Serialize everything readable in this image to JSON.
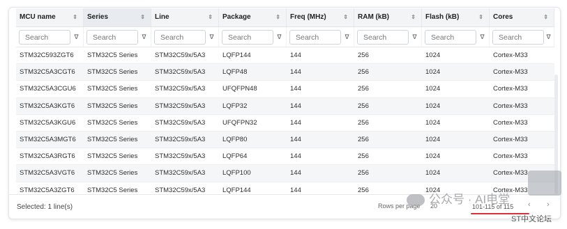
{
  "columns": [
    {
      "label": "MCU name",
      "width": 97
    },
    {
      "label": "Series",
      "width": 97,
      "active": true
    },
    {
      "label": "Line",
      "width": 97
    },
    {
      "label": "Package",
      "width": 97
    },
    {
      "label": "Freq (MHz)",
      "width": 97
    },
    {
      "label": "RAM (kB)",
      "width": 97
    },
    {
      "label": "Flash (kB)",
      "width": 97
    },
    {
      "label": "Cores",
      "width": 93
    }
  ],
  "filter_placeholder": "Search",
  "rows": [
    [
      "STM32C593ZGT6",
      "STM32C5 Series",
      "STM32C59x/5A3",
      "LQFP144",
      "144",
      "256",
      "1024",
      "Cortex-M33"
    ],
    [
      "STM32C5A3CGT6",
      "STM32C5 Series",
      "STM32C59x/5A3",
      "LQFP48",
      "144",
      "256",
      "1024",
      "Cortex-M33"
    ],
    [
      "STM32C5A3CGU6",
      "STM32C5 Series",
      "STM32C59x/5A3",
      "UFQFPN48",
      "144",
      "256",
      "1024",
      "Cortex-M33"
    ],
    [
      "STM32C5A3KGT6",
      "STM32C5 Series",
      "STM32C59x/5A3",
      "LQFP32",
      "144",
      "256",
      "1024",
      "Cortex-M33"
    ],
    [
      "STM32C5A3KGU6",
      "STM32C5 Series",
      "STM32C59x/5A3",
      "UFQFPN32",
      "144",
      "256",
      "1024",
      "Cortex-M33"
    ],
    [
      "STM32C5A3MGT6",
      "STM32C5 Series",
      "STM32C59x/5A3",
      "LQFP80",
      "144",
      "256",
      "1024",
      "Cortex-M33"
    ],
    [
      "STM32C5A3RGT6",
      "STM32C5 Series",
      "STM32C59x/5A3",
      "LQFP64",
      "144",
      "256",
      "1024",
      "Cortex-M33"
    ],
    [
      "STM32C5A3VGT6",
      "STM32C5 Series",
      "STM32C59x/5A3",
      "LQFP100",
      "144",
      "256",
      "1024",
      "Cortex-M33"
    ],
    [
      "STM32C5A3ZGT6",
      "STM32C5 Series",
      "STM32C59x/5A3",
      "LQFP144",
      "144",
      "256",
      "1024",
      "Cortex-M33"
    ]
  ],
  "footer": {
    "selected": "Selected: 1 line(s)",
    "rows_per_page_label": "Rows per page",
    "rows_per_page_value": "20",
    "range": "101-115 of 115",
    "prev_icon": "‹",
    "next_icon": "›"
  },
  "watermark": {
    "text": "公众号 · AI电堂",
    "sub": "ST中文论坛"
  },
  "colors": {
    "underline": "#d9313b",
    "header_bg": "#f3f4f6",
    "alt_row": "#f5f6f8"
  }
}
